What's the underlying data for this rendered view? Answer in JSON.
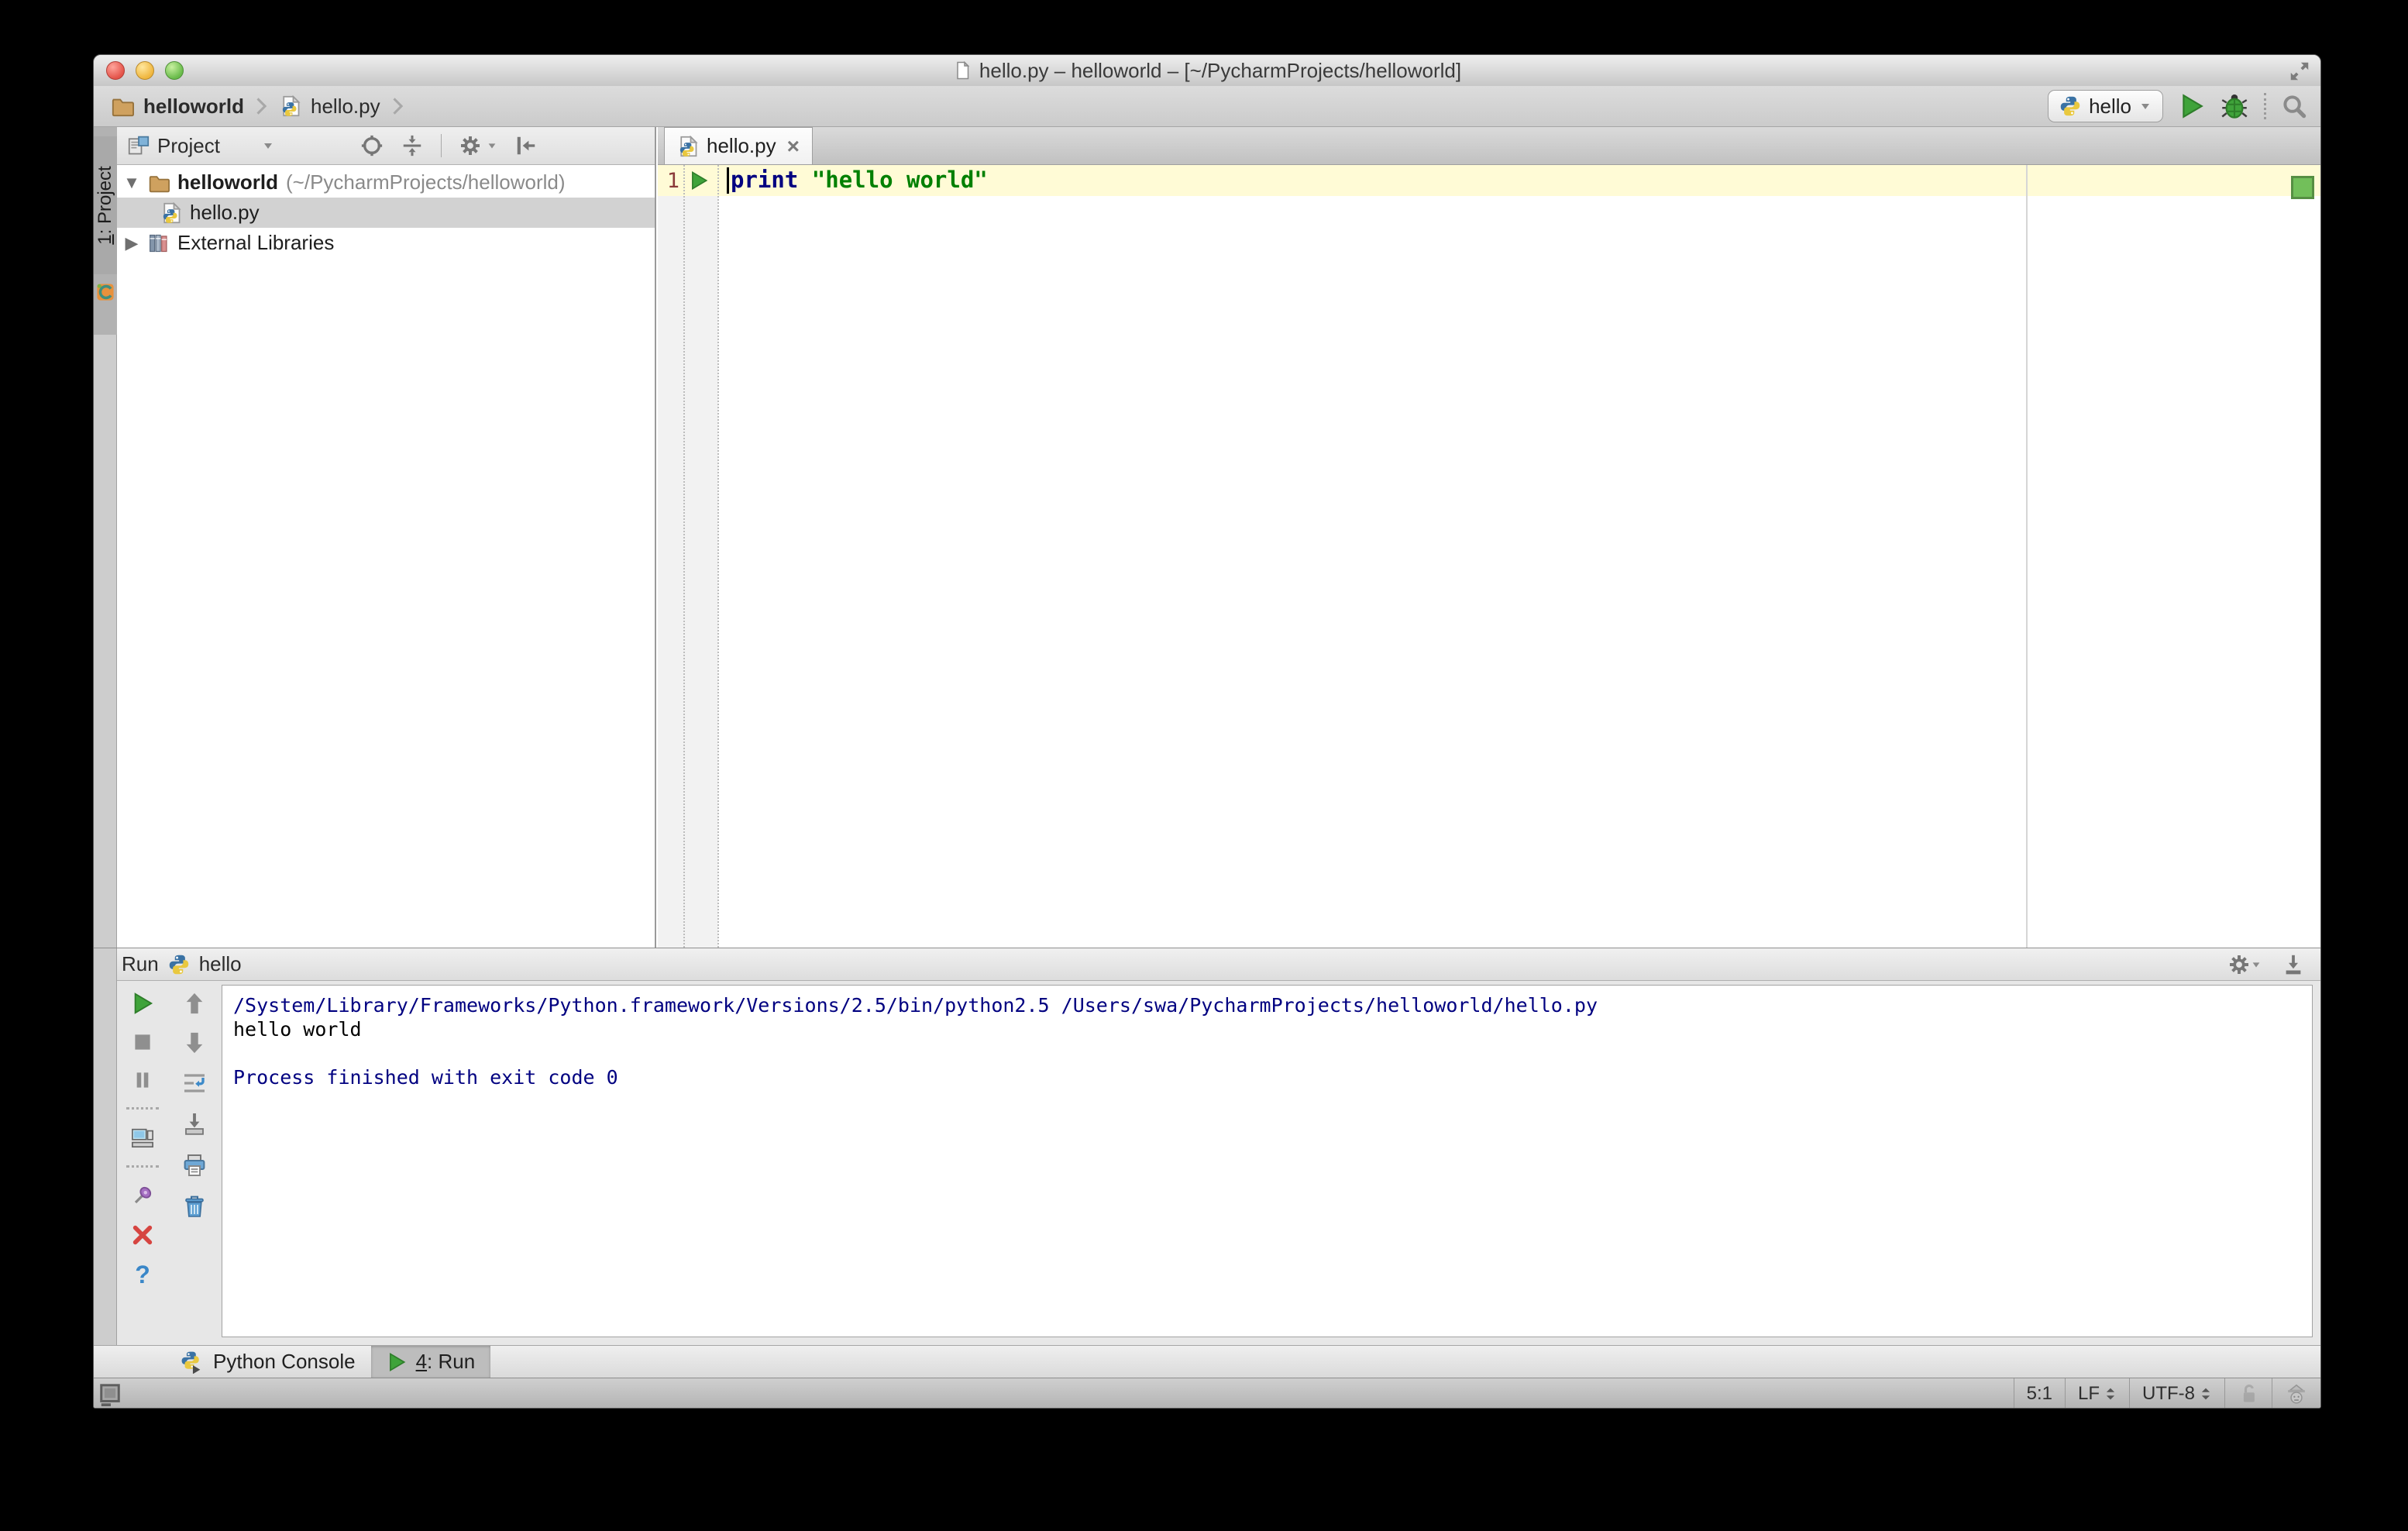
{
  "window": {
    "title": "hello.py – helloworld – [~/PycharmProjects/helloworld]"
  },
  "toolbar": {
    "breadcrumbs": [
      {
        "label": "helloworld"
      },
      {
        "label": "hello.py"
      }
    ],
    "run_config": {
      "label": "hello"
    }
  },
  "left_stripe": {
    "project_tab": {
      "mnemonic": "1",
      "label": ": Project"
    }
  },
  "project_panel": {
    "header": {
      "title": "Project"
    },
    "tree": {
      "root": {
        "name": "helloworld",
        "path": "(~/PycharmProjects/helloworld)"
      },
      "file": {
        "name": "hello.py"
      },
      "libraries": {
        "name": "External Libraries"
      }
    }
  },
  "editor": {
    "tab": {
      "title": "hello.py",
      "close_glyph": "×"
    },
    "gutter": {
      "line_number": "1"
    },
    "code": {
      "keyword": "print",
      "string_literal": "\"hello world\""
    }
  },
  "run_panel": {
    "header": {
      "title": "Run",
      "config_name": "hello"
    },
    "toolbar": {
      "help_glyph": "?"
    },
    "console": {
      "lines": [
        {
          "text": "/System/Library/Frameworks/Python.framework/Versions/2.5/bin/python2.5 /Users/swa/PycharmProjects/helloworld/hello.py",
          "style": "system"
        },
        {
          "text": "hello world",
          "style": "stdout"
        },
        {
          "text": "",
          "style": "stdout"
        },
        {
          "text": "Process finished with exit code 0",
          "style": "system"
        }
      ]
    }
  },
  "bottom_bar": {
    "python_console_tab": {
      "label": "Python Console"
    },
    "run_tab": {
      "mnemonic": "4",
      "label": ": Run"
    }
  },
  "status_bar": {
    "caret_position": "5:1",
    "line_separator": "LF",
    "encoding": "UTF-8"
  },
  "colors": {
    "keyword": "#000080",
    "string_literal": "#008000",
    "console_system_text": "#000080",
    "console_stdout_text": "#000000",
    "current_line_highlight": "#fffbd6",
    "inactive_selection": "#d2d2d2",
    "run_green": "#3fa33a",
    "inspection_ok_green": "#72bf5a",
    "line_number": "#8b3a3a"
  },
  "icons": {
    "document-icon": "white page, folded corner",
    "folder-icon": "tan folder",
    "python-file-icon": "page with python logo",
    "python-logo-icon": "blue/yellow snakes",
    "run-icon": "green triangle",
    "debug-icon": "green bug",
    "search-icon": "magnifier",
    "settings-icon": "gear",
    "locate-icon": "crosshair circle",
    "collapse-all-icon": "arrows to line",
    "hide-panel-icon": "bar with left arrow",
    "external-libraries-icon": "three books",
    "stop-icon": "gray square",
    "pause-icon": "double bars",
    "restore-layout-icon": "monitor",
    "pin-icon": "purple pin",
    "close-icon": "red ×",
    "help-icon": "blue ?",
    "up-arrow-icon": "gray up arrow",
    "down-arrow-icon": "gray down arrow",
    "soft-wrap-icon": "lines with blue wrap arrows",
    "scroll-to-end-icon": "down arrow onto tray",
    "print-icon": "blue printer",
    "clear-all-icon": "blue trash can",
    "dock-icon": "down arrow onto bar",
    "unlock-icon": "open gray padlock",
    "inspector-icon": "hector profile head",
    "fullscreen-icon": "diagonal expand arrows",
    "spinner-icon": "up/down triangles",
    "toggle-toolwindows-icon": "small framed square"
  }
}
